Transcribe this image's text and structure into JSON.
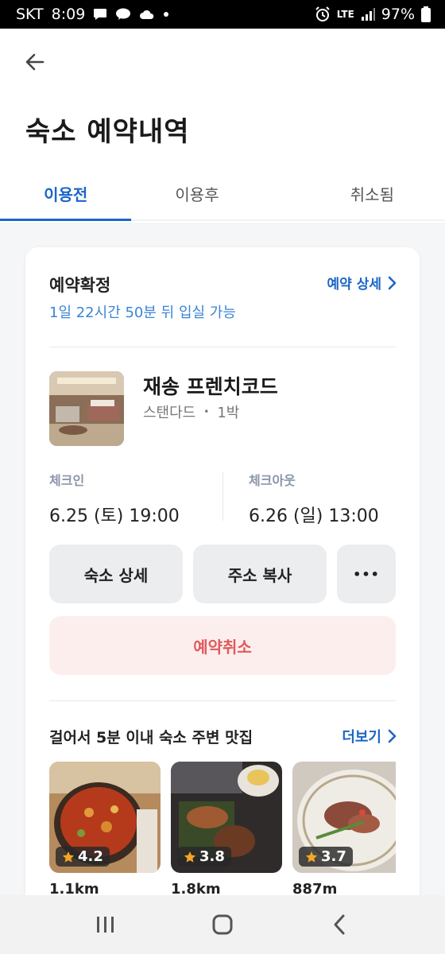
{
  "status_bar": {
    "carrier": "SKT",
    "time": "8:09",
    "network": "LTE",
    "battery": "97%"
  },
  "header": {
    "title": "숙소 예약내역"
  },
  "tabs": [
    {
      "label": "이용전",
      "active": true
    },
    {
      "label": "이용후",
      "active": false
    },
    {
      "label": "취소됨",
      "active": false
    }
  ],
  "reservation": {
    "status": "예약확정",
    "detail_link": "예약 상세",
    "checkin_remaining": "1일 22시간 50분 뒤 입실 가능",
    "hotel_name": "재송 프렌치코드",
    "room_type": "스탠다드",
    "nights": "1박",
    "checkin_label": "체크인",
    "checkin_value": "6.25 (토) 19:00",
    "checkout_label": "체크아웃",
    "checkout_value": "6.26 (일) 13:00",
    "buttons": {
      "hotel_detail": "숙소 상세",
      "copy_address": "주소 복사",
      "more": "•••",
      "cancel": "예약취소"
    }
  },
  "nearby": {
    "title": "걸어서 5분 이내 숙소 주변 맛집",
    "more_link": "더보기",
    "items": [
      {
        "rating": "4.2",
        "distance": "1.1km"
      },
      {
        "rating": "3.8",
        "distance": "1.8km"
      },
      {
        "rating": "3.7",
        "distance": "887m"
      }
    ]
  },
  "colors": {
    "accent": "#1a66c8",
    "remaining_text": "#3a86d4",
    "cancel_text": "#e05a5a",
    "cancel_bg": "#fdeeee",
    "star": "#f5a623"
  }
}
